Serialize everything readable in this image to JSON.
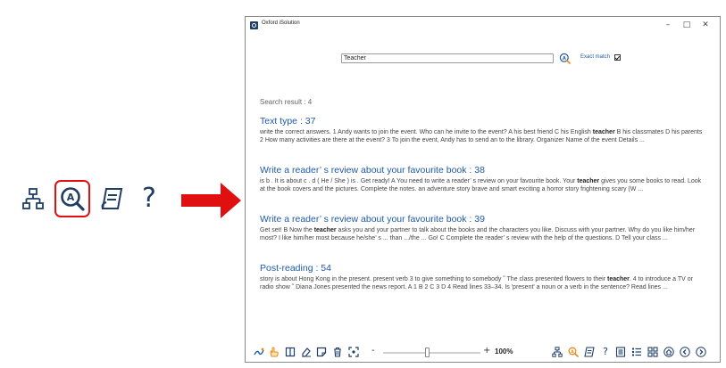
{
  "window": {
    "title": "Oxford iSolution",
    "controls": {
      "minimize": "–",
      "maximize": "□",
      "close": "✕"
    }
  },
  "search": {
    "query": "Teacher",
    "button_icon": "search-icon",
    "exact_match_label": "Exact match",
    "exact_match_checked": true
  },
  "results": {
    "summary": "Search result : 4",
    "items": [
      {
        "title": "Text type : 37",
        "snippet_before": "write the correct answers. 1 Andy wants to join the event. Who can he invite to the event? A his best friend C his English ",
        "highlight": "teacher",
        "snippet_after": " B his classmates D his parents 2 How many activities are there at the event? 3 To join the event, Andy has to send an to the library. Organizer Name of the event Details  ..."
      },
      {
        "title": "Write a reader’ s review about your favourite book : 38",
        "snippet_before": "is b . It is about c . d ( He / She ) is . Get ready! A You need to write a reader’ s review on your favourite book. Your ",
        "highlight": "teacher",
        "snippet_after": " gives you some books to read. Look at the book covers and the pictures. Complete the notes. an adventure story brave and smart exciting a horror story frightening scary (W  ..."
      },
      {
        "title": "Write a reader’ s review about your favourite book : 39",
        "snippet_before": "Get set! B Now the ",
        "highlight": "teacher",
        "snippet_after": " asks you and your partner to talk about the books and the characters you like. Discuss with your partner. Why do you like him/her most? I like him/her most because he/she’ s ... than .../the ... Go! C Complete the reader’ s review with the help of the questions. D Tell your class  ..."
      },
      {
        "title": "Post-reading : 54",
        "snippet_before": "story is about Hong Kong in the present. present verb 3 to give something to somebody ˜ The class presented flowers to their ",
        "highlight": "teacher",
        "snippet_after": ". 4 to introduce a TV or radio show ˜ Diana Jones presented the news report. A 1 B 2 C 3 D 4 Read lines 33–34. Is   'present' a noun or a verb in the sentence? Read lines  ..."
      }
    ]
  },
  "left_toolbar": {
    "icons": [
      "sitemap-icon",
      "search-icon",
      "notes-icon",
      "help-icon"
    ],
    "help_glyph": "?",
    "highlighted": "search-icon"
  },
  "bottom_toolbar": {
    "left_icons": [
      "draw-icon",
      "hand-icon",
      "book-icon",
      "eraser-icon",
      "note-icon",
      "trash-icon",
      "fit-icon"
    ],
    "zoom_minus": "-",
    "zoom_plus": "+",
    "zoom_value": "100%",
    "zoom_level_fraction": 0.45,
    "right_icons": [
      "sitemap-icon",
      "search-icon",
      "notes-icon",
      "help-icon",
      "list-icon",
      "bullets-icon",
      "grid-icon",
      "home-icon",
      "prev-icon",
      "next-icon"
    ],
    "help_glyph": "?"
  },
  "colors": {
    "accent": "#1f5aa8",
    "icon_dark": "#1f3e66",
    "highlight_red": "#e01010",
    "search_orange": "#e88a1a"
  }
}
